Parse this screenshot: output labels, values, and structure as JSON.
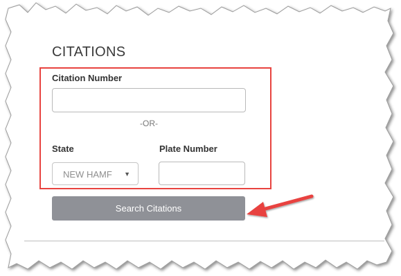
{
  "section": {
    "title": "CITATIONS"
  },
  "citation": {
    "label": "Citation Number",
    "value": "",
    "placeholder": ""
  },
  "separator": {
    "text": "-OR-"
  },
  "state": {
    "label": "State",
    "selected": "NEW HAMF"
  },
  "plate": {
    "label": "Plate Number",
    "value": "",
    "placeholder": ""
  },
  "search_button": {
    "label": "Search Citations"
  },
  "colors": {
    "highlight": "#e8433f",
    "button_bg": "#8f9197",
    "button_text": "#ffffff",
    "arrow": "#e8433f"
  },
  "icons": {
    "select_caret": "caret-down-icon",
    "annotation": "arrow-left-icon"
  }
}
